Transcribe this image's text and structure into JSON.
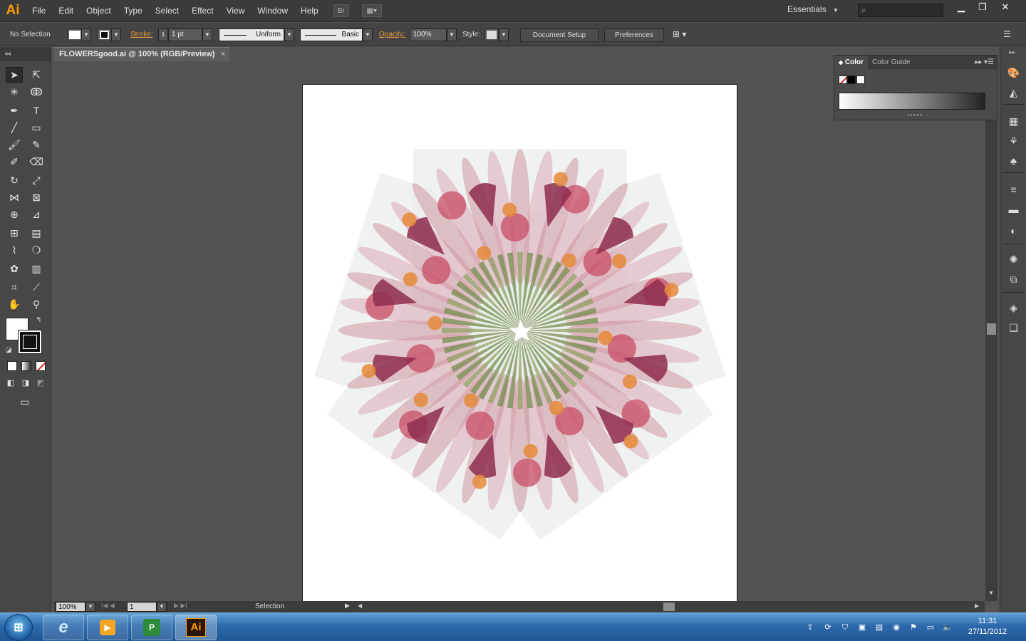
{
  "app": {
    "logo": "Ai"
  },
  "menu": [
    "File",
    "Edit",
    "Object",
    "Type",
    "Select",
    "Effect",
    "View",
    "Window",
    "Help"
  ],
  "menubar": {
    "bridge_label": "Br",
    "workspace": "Essentials",
    "search_icon": "⌕"
  },
  "control": {
    "selection_status": "No Selection",
    "stroke_label": "Stroke:",
    "stroke_weight": "1 pt",
    "variable_width": "Uniform",
    "brush": "Basic",
    "opacity_label": "Opacity:",
    "opacity_value": "100%",
    "style_label": "Style:",
    "document_setup": "Document Setup",
    "preferences": "Preferences"
  },
  "document": {
    "tab_title": "FLOWERSgood.ai @ 100% (RGB/Preview)",
    "close": "×"
  },
  "status": {
    "zoom": "100%",
    "artboard_number": "1",
    "tool_status": "Selection"
  },
  "color_panel": {
    "tabs": [
      "Color",
      "Color Guide"
    ],
    "active_tab": "Color"
  },
  "artwork": {
    "accent_colors": [
      "#8e2d4e",
      "#c84d66",
      "#e58a3a",
      "#6e8a46",
      "#d48a9a"
    ]
  },
  "taskbar": {
    "time": "11:31",
    "date": "27/11/2012",
    "active_app": "Ai"
  }
}
